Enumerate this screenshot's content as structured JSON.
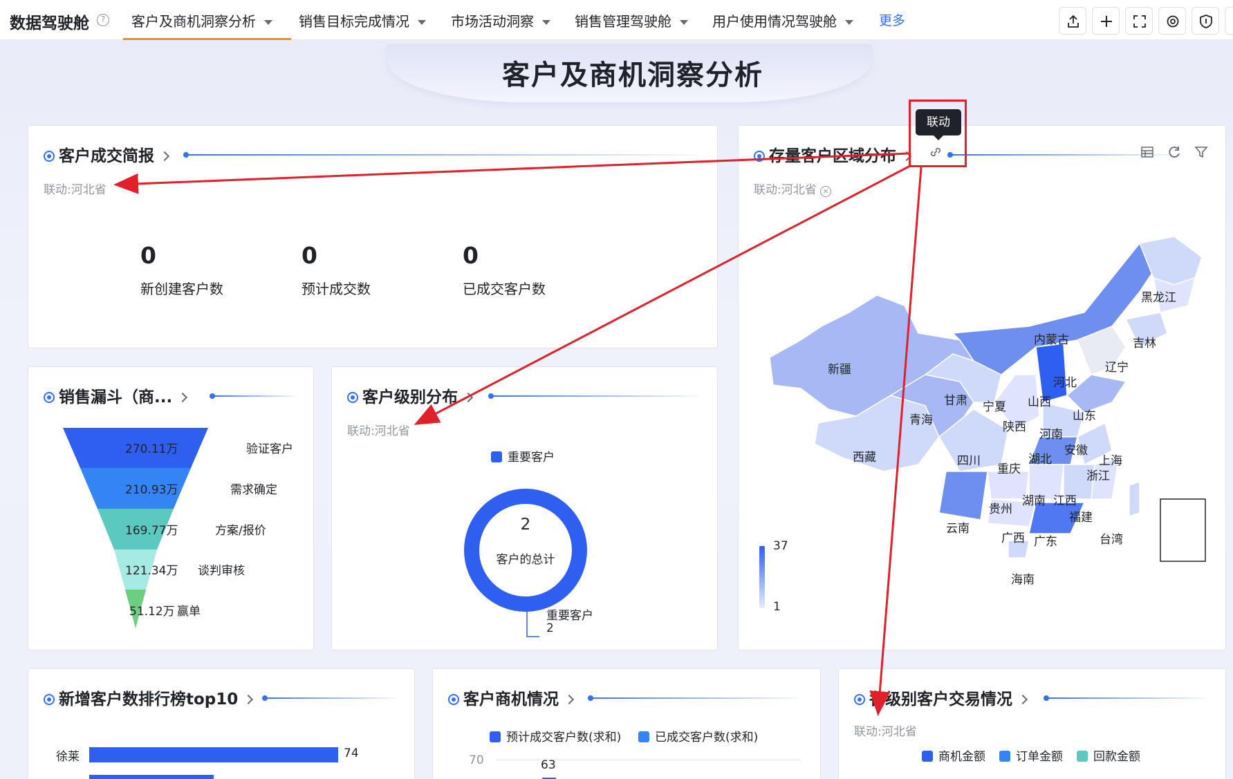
{
  "nav": {
    "brand": "数据驾驶舱",
    "tabs": [
      "客户及商机洞察分析",
      "销售目标完成情况",
      "市场活动洞察",
      "销售管理驾驶舱",
      "用户使用情况驾驶舱"
    ],
    "more": "更多"
  },
  "page_title": "客户及商机洞察分析",
  "tooltip": "联动",
  "cards": {
    "deal_brief": {
      "title": "客户成交简报",
      "link": "联动:河北省",
      "kpis": [
        {
          "value": "0",
          "label": "新创建客户数"
        },
        {
          "value": "0",
          "label": "预计成交数"
        },
        {
          "value": "0",
          "label": "已成交客户数"
        }
      ]
    },
    "region": {
      "title": "存量客户区域分布",
      "link": "联动:河北省",
      "legend_max": "37",
      "legend_min": "1",
      "provinces": [
        "黑龙江",
        "吉林",
        "辽宁",
        "内蒙古",
        "新疆",
        "河北",
        "山西",
        "山东",
        "甘肃",
        "宁夏",
        "陕西",
        "河南",
        "青海",
        "西藏",
        "四川",
        "重庆",
        "湖北",
        "安徽",
        "上海",
        "浙江",
        "江西",
        "湖南",
        "贵州",
        "云南",
        "广西",
        "广东",
        "福建",
        "台湾",
        "海南"
      ]
    },
    "funnel": {
      "title": "销售漏斗（商...",
      "stages": [
        {
          "value": "270.11万",
          "label": "验证客户"
        },
        {
          "value": "210.93万",
          "label": "需求确定"
        },
        {
          "value": "169.77万",
          "label": "方案/报价"
        },
        {
          "value": "121.34万",
          "label": "谈判审核"
        },
        {
          "value": "51.12万",
          "label": "赢单"
        }
      ]
    },
    "level": {
      "title": "客户级别分布",
      "link": "联动:河北省",
      "legend": "重要客户",
      "total": "2",
      "total_label": "客户的总计",
      "slice_label": "重要客户",
      "slice_value": "2"
    },
    "ranking": {
      "title": "新增客户数排行榜top10",
      "rows": [
        {
          "name": "徐莱",
          "value": "74"
        }
      ]
    },
    "opportunity": {
      "title": "客户商机情况",
      "legend": [
        "预计成交客户数(求和)",
        "已成交客户数(求和)"
      ],
      "y_tick": "70",
      "bar_label": "63"
    },
    "trade": {
      "title": "各级别客户交易情况",
      "link": "联动:河北省",
      "legend": [
        "商机金额",
        "订单金额",
        "回款金额"
      ]
    }
  },
  "colors": {
    "accent": "#3370ff",
    "annotation": "#e0202a",
    "funnel": [
      "#2f5ff0",
      "#3385f5",
      "#5cc9c0",
      "#a6ebe3",
      "#6bcf7f"
    ]
  }
}
